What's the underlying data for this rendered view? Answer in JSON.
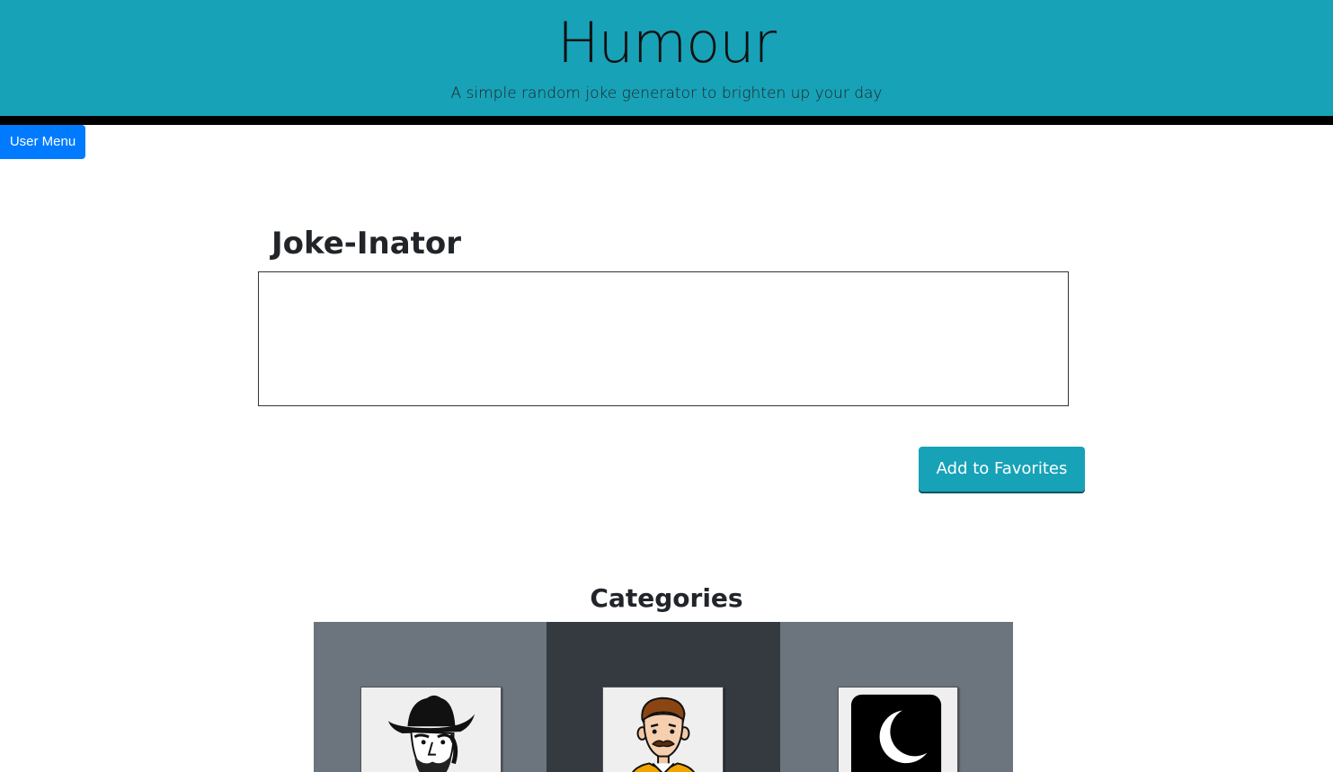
{
  "header": {
    "title": "Humour",
    "subtitle": "A simple random joke generator to brighten up your day",
    "background_color": "#17a2b8"
  },
  "user_menu": {
    "label": "User Menu",
    "color": "#007bff"
  },
  "joke_section": {
    "title": "Joke-Inator",
    "joke_text": ""
  },
  "favorites": {
    "button_label": "Add to Favorites"
  },
  "categories": {
    "title": "Categories",
    "items": [
      {
        "icon": "cowboy-portrait-icon"
      },
      {
        "icon": "mustache-man-icon"
      },
      {
        "icon": "crescent-moon-icon"
      }
    ]
  }
}
